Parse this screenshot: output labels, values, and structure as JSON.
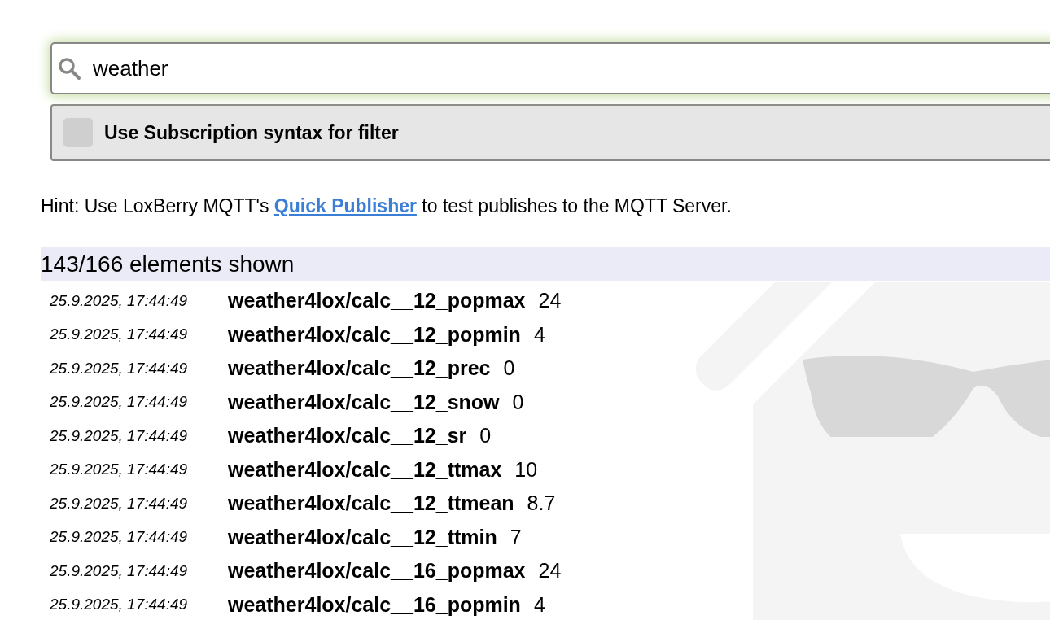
{
  "search": {
    "value": "weather"
  },
  "subscription_filter": {
    "label": "Use Subscription syntax for filter",
    "checked": false
  },
  "hint": {
    "before": "Hint: Use LoxBerry MQTT's",
    "link": "Quick Publisher",
    "after": "to test publishes to the MQTT Server."
  },
  "count": "143/166 elements shown",
  "rows": [
    {
      "time": "25.9.2025, 17:44:49",
      "topic": "weather4lox/calc__12_popmax",
      "value": "24"
    },
    {
      "time": "25.9.2025, 17:44:49",
      "topic": "weather4lox/calc__12_popmin",
      "value": "4"
    },
    {
      "time": "25.9.2025, 17:44:49",
      "topic": "weather4lox/calc__12_prec",
      "value": "0"
    },
    {
      "time": "25.9.2025, 17:44:49",
      "topic": "weather4lox/calc__12_snow",
      "value": "0"
    },
    {
      "time": "25.9.2025, 17:44:49",
      "topic": "weather4lox/calc__12_sr",
      "value": "0"
    },
    {
      "time": "25.9.2025, 17:44:49",
      "topic": "weather4lox/calc__12_ttmax",
      "value": "10"
    },
    {
      "time": "25.9.2025, 17:44:49",
      "topic": "weather4lox/calc__12_ttmean",
      "value": "8.7"
    },
    {
      "time": "25.9.2025, 17:44:49",
      "topic": "weather4lox/calc__12_ttmin",
      "value": "7"
    },
    {
      "time": "25.9.2025, 17:44:49",
      "topic": "weather4lox/calc__16_popmax",
      "value": "24"
    },
    {
      "time": "25.9.2025, 17:44:49",
      "topic": "weather4lox/calc__16_popmin",
      "value": "4"
    }
  ]
}
